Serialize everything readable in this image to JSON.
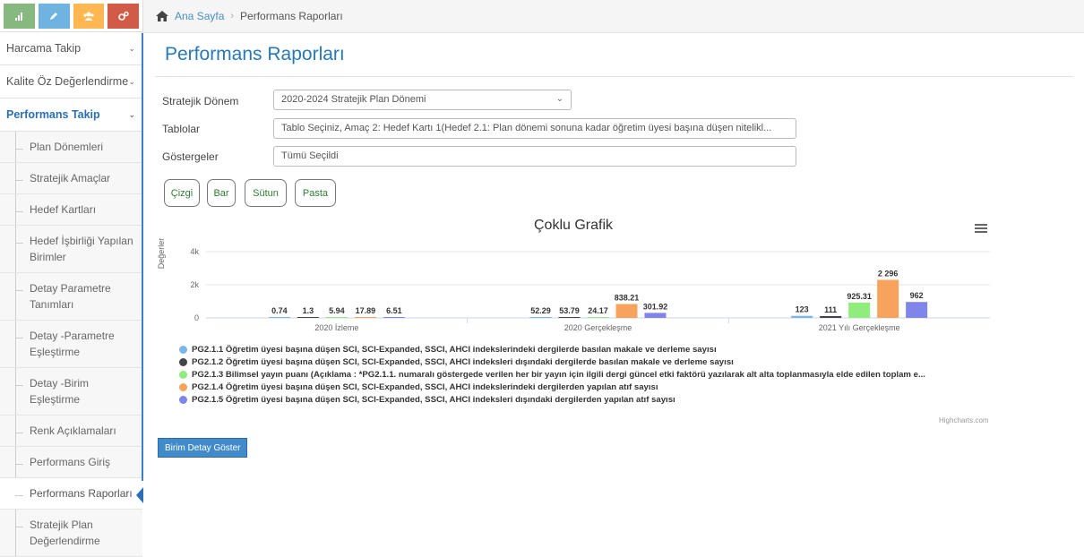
{
  "breadcrumb": {
    "home": "Ana Sayfa",
    "current": "Performans Raporları"
  },
  "sidebar": {
    "shortcuts": [
      {
        "icon": "bar-chart-icon",
        "color": "#87b87f"
      },
      {
        "icon": "pencil-icon",
        "color": "#6fb3e0"
      },
      {
        "icon": "users-icon",
        "color": "#ffb752"
      },
      {
        "icon": "cogs-icon",
        "color": "#d15b47"
      }
    ],
    "menu": [
      {
        "label": "Harcama Takip"
      },
      {
        "label": "Kalite Öz Değerlendirme"
      },
      {
        "label": "Performans Takip"
      }
    ],
    "submenu": [
      "Plan Dönemleri",
      "Stratejik Amaçlar",
      "Hedef Kartları",
      "Hedef İşbirliği Yapılan Birimler",
      "Detay Parametre Tanımları",
      "Detay -Parametre Eşleştirme",
      "Detay -Birim Eşleştirme",
      "Renk Açıklamaları",
      "Performans Giriş",
      "Performans Raporları",
      "Stratejik Plan Değerlendirme"
    ]
  },
  "page": {
    "title": "Performans Raporları"
  },
  "form": {
    "period_label": "Stratejik Dönem",
    "period_value": "2020-2024 Stratejik Plan Dönemi",
    "tables_label": "Tablolar",
    "tables_value": "Tablo Seçiniz, Amaç 2: Hedef Kartı 1(Hedef 2.1: Plan dönemi sonuna kadar öğretim üyesi başına düşen nitelikl...",
    "indicators_label": "Göstergeler",
    "indicators_value": "Tümü Seçildi"
  },
  "chart_buttons": [
    "Çizgi",
    "Bar",
    "Sütun",
    "Pasta"
  ],
  "detail_button": "Birim Detay Göster",
  "credits": "Highcharts.com",
  "chart_data": {
    "type": "bar",
    "title": "Çoklu Grafik",
    "ylabel": "Değerler",
    "ylim": [
      0,
      4000
    ],
    "yticks": [
      "0",
      "2k",
      "4k"
    ],
    "categories": [
      "2020 İzleme",
      "2020 Gerçekleşme",
      "2021 Yılı Gerçekleşme"
    ],
    "grid": true,
    "legend": "bottom",
    "series": [
      {
        "name": "PG2.1.1 Öğretim üyesi başına düşen SCI, SCI-Expanded, SSCI, AHCI indekslerindeki dergilerde basılan makale ve derleme sayısı",
        "color": "#7cb5ec",
        "values": [
          0.74,
          52.29,
          123
        ],
        "labels": [
          "0.74",
          "52.29",
          "123"
        ]
      },
      {
        "name": "PG2.1.2 Öğretim üyesi başına düşen SCI, SCI-Expanded, SSCI, AHCI indeksleri dışındaki dergilerde basılan makale ve derleme sayısı",
        "color": "#434348",
        "values": [
          1.3,
          53.79,
          111
        ],
        "labels": [
          "1.3",
          "53.79",
          "111"
        ]
      },
      {
        "name": "PG2.1.3 Bilimsel yayın puanı (Açıklama : *PG2.1.1. numaralı göstergede verilen her bir yayın için ilgili dergi güncel etki faktörü yazılarak alt alta toplanmasıyla elde edilen toplam e...",
        "color": "#90ed7d",
        "values": [
          5.94,
          24.17,
          925.31
        ],
        "labels": [
          "5.94",
          "24.17",
          "925.31"
        ]
      },
      {
        "name": "PG2.1.4 Öğretim üyesi başına düşen SCI, SCI-Expanded, SSCI, AHCI indekslerindeki dergilerden yapılan atıf sayısı",
        "color": "#f7a35c",
        "values": [
          17.89,
          838.21,
          2296
        ],
        "labels": [
          "17.89",
          "838.21",
          "2 296"
        ]
      },
      {
        "name": "PG2.1.5 Öğretim üyesi başına düşen SCI, SCI-Expanded, SSCI, AHCI indeksleri dışındaki dergilerden yapılan atıf sayısı",
        "color": "#8085e9",
        "values": [
          6.51,
          301.92,
          962
        ],
        "labels": [
          "6.51",
          "301.92",
          "962"
        ]
      }
    ]
  }
}
